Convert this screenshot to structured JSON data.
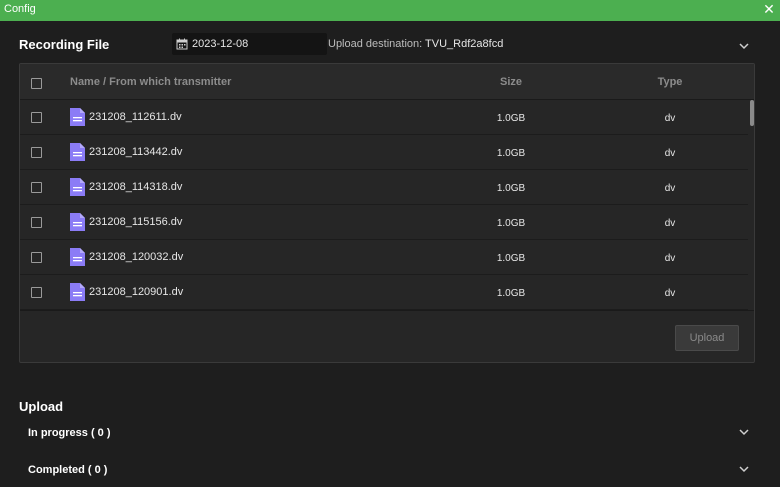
{
  "window": {
    "title": "Config"
  },
  "recording": {
    "title": "Recording File",
    "date": "2023-12-08",
    "destination_label": "Upload destination:",
    "destination_value": "TVU_Rdf2a8fcd"
  },
  "table": {
    "headers": {
      "name": "Name / From which transmitter",
      "size": "Size",
      "type": "Type"
    },
    "rows": [
      {
        "name": "231208_112611.dv",
        "size": "1.0GB",
        "type": "dv"
      },
      {
        "name": "231208_113442.dv",
        "size": "1.0GB",
        "type": "dv"
      },
      {
        "name": "231208_114318.dv",
        "size": "1.0GB",
        "type": "dv"
      },
      {
        "name": "231208_115156.dv",
        "size": "1.0GB",
        "type": "dv"
      },
      {
        "name": "231208_120032.dv",
        "size": "1.0GB",
        "type": "dv"
      },
      {
        "name": "231208_120901.dv",
        "size": "1.0GB",
        "type": "dv"
      }
    ],
    "upload_label": "Upload"
  },
  "upload": {
    "title": "Upload",
    "in_progress": "In progress ( 0 )",
    "completed": "Completed ( 0 )"
  },
  "icons": {
    "file": "file-document-icon",
    "calendar": "calendar-icon",
    "close": "close-icon",
    "chevron": "chevron-down-icon"
  },
  "colors": {
    "titlebar": "#4caf50",
    "background": "#1e1e1e",
    "file_icon": "#8b7cf6"
  }
}
